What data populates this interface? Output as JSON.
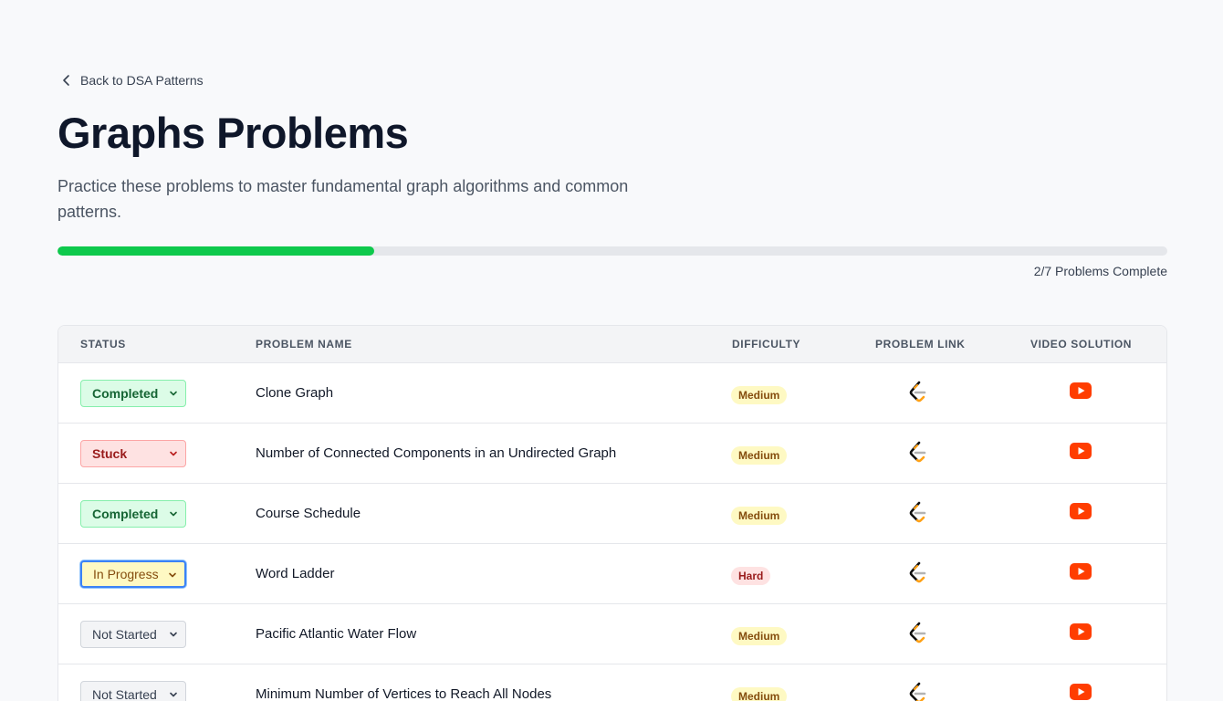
{
  "back_link": {
    "label": "Back to DSA Patterns"
  },
  "header": {
    "title": "Graphs Problems",
    "subtitle": "Practice these problems to master fundamental graph algorithms and common patterns."
  },
  "progress": {
    "completed": 2,
    "total": 7,
    "fraction": 0.2857,
    "label": "2/7 Problems Complete"
  },
  "table": {
    "columns": [
      "Status",
      "Problem Name",
      "Difficulty",
      "Problem Link",
      "Video Solution"
    ],
    "rows": [
      {
        "status": "Completed",
        "name": "Clone Graph",
        "difficulty": "Medium"
      },
      {
        "status": "Stuck",
        "name": "Number of Connected Components in an Undirected Graph",
        "difficulty": "Medium"
      },
      {
        "status": "Completed",
        "name": "Course Schedule",
        "difficulty": "Medium"
      },
      {
        "status": "In Progress",
        "name": "Word Ladder",
        "difficulty": "Hard"
      },
      {
        "status": "Not Started",
        "name": "Pacific Atlantic Water Flow",
        "difficulty": "Medium"
      },
      {
        "status": "Not Started",
        "name": "Minimum Number of Vertices to Reach All Nodes",
        "difficulty": "Medium"
      }
    ]
  },
  "icons": {
    "back": "chevron-left-icon",
    "select": "chevron-down-icon",
    "problem_link": "leetcode-icon",
    "video": "youtube-icon"
  },
  "colors": {
    "progress_fill": "#0ec94c",
    "progress_track": "#e5e7eb",
    "youtube_red": "#ff3d00",
    "leetcode_orange": "#ffa116"
  }
}
